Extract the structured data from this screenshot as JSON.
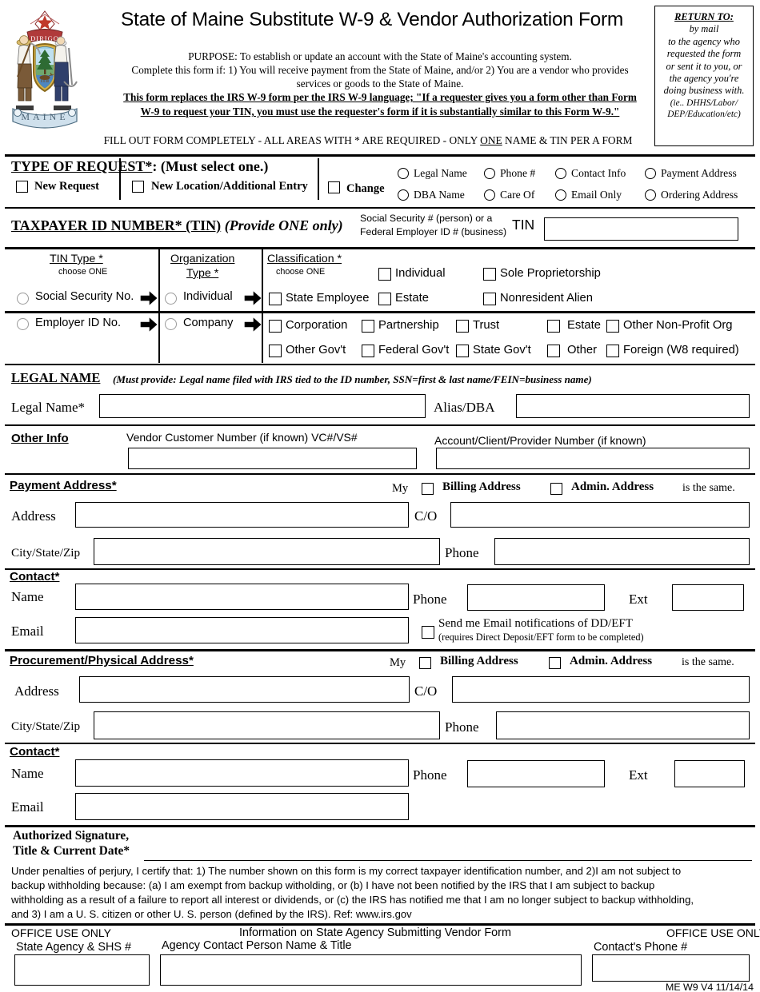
{
  "header": {
    "title": "State of Maine Substitute W-9 & Vendor Authorization Form",
    "seal_alt": "maine-state-seal",
    "purpose_line1": "PURPOSE: To establish or update an account with the State of Maine's accounting system.",
    "purpose_line2": "Complete this form if: 1) You will receive payment from the State of Maine, and/or 2) You are a vendor who provides",
    "purpose_line3": "services or goods to the State of Maine.",
    "replaces_line1": "This form replaces the IRS W-9 form per the IRS W-9 language; \"If a requester gives you a form other than Form",
    "replaces_line2": "W-9 to request your TIN, you must use the requester's form if it is substantially similar to this Form W-9.\"",
    "fillout_pre": "FILL OUT FORM COMPLETELY - ALL AREAS WITH * ARE REQUIRED - ONLY ",
    "fillout_underline": "ONE",
    "fillout_post": " NAME & TIN PER A FORM"
  },
  "return_box": {
    "title": "RETURN TO",
    "title_colon": ":",
    "lines": [
      "by mail",
      "to the agency who",
      "requested the form",
      "or sent it to you, or",
      "the agency you're",
      "doing business with."
    ],
    "small_line1": "(ie.. DHHS/Labor/",
    "small_line2": "DEP/Education/etc)"
  },
  "type_of_request": {
    "heading": "TYPE OF REQUEST*",
    "heading_suffix": ": (Must select one.)",
    "new_request": "New Request",
    "new_location": "New Location/Additional Entry",
    "change": "Change",
    "change_options_row1": [
      "Legal Name",
      "Phone #",
      "Contact Info",
      "Payment Address"
    ],
    "change_options_row2": [
      "DBA Name",
      "Care Of",
      "Email Only",
      "Ordering Address"
    ]
  },
  "tin_section": {
    "heading": "TAXPAYER ID NUMBER* (TIN)",
    "heading_italic": " (Provide ONE only)",
    "hint_line1": "Social Security #  (person) or a",
    "hint_line2": "Federal Employer ID # (business)",
    "tin_label": "TIN",
    "tin_value": ""
  },
  "tin_type": {
    "heading": "TIN Type *",
    "subheading": "choose ONE",
    "options": [
      "Social Security No.",
      "Employer ID No."
    ]
  },
  "org_type": {
    "heading_line1": "Organization",
    "heading_line2": "Type *",
    "options": [
      "Individual",
      "Company"
    ]
  },
  "classification": {
    "heading": "Classification *",
    "subheading": "choose ONE",
    "individual_row1": [
      "Individual",
      "Sole Proprietorship"
    ],
    "individual_row2": [
      "State Employee",
      "Estate",
      "Nonresident Alien"
    ],
    "company_row1": [
      "Corporation",
      "Partnership",
      "Trust",
      "Estate",
      "Other Non-Profit Org"
    ],
    "company_row2": [
      "Other Gov't",
      "Federal Gov't",
      "State Gov't",
      "Other",
      "Foreign (W8 required)"
    ]
  },
  "legal_name": {
    "heading": "LEGAL NAME",
    "heading_note": "(Must provide: Legal name filed with IRS tied to the ID number, SSN=first & last name/FEIN=business name)",
    "legal_name_label": "Legal Name*",
    "legal_name_value": "",
    "alias_label": "Alias/DBA",
    "alias_value": ""
  },
  "other_info": {
    "heading": "Other Info",
    "vendor_number_label": "Vendor Customer Number (if known) VC#/VS#",
    "vendor_number_value": "",
    "account_number_label": "Account/Client/Provider Number (if known)",
    "account_number_value": ""
  },
  "payment_address": {
    "heading": "Payment Address*",
    "same_pre": "My",
    "same_billing": "Billing Address",
    "same_admin": "Admin. Address",
    "same_post": "is the same.",
    "address_label": "Address",
    "address_value": "",
    "co_label": "C/O",
    "co_value": "",
    "citystatezip_label": "City/State/Zip",
    "citystatezip_value": "",
    "phone_label": "Phone",
    "phone_value": "",
    "contact_heading": "Contact*",
    "name_label": "Name",
    "name_value": "",
    "contact_phone_label": "Phone",
    "contact_phone_value": "",
    "ext_label": "Ext",
    "ext_value": "",
    "email_label": "Email",
    "email_value": "",
    "dd_eft_line1": "Send me Email notifications of DD/EFT",
    "dd_eft_line2": "(requires Direct Deposit/EFT form to be completed)"
  },
  "procurement_address": {
    "heading": "Procurement/Physical Address*",
    "same_pre": "My",
    "same_billing": "Billing Address",
    "same_admin": "Admin. Address",
    "same_post": "is the same.",
    "address_label": "Address",
    "address_value": "",
    "co_label": "C/O",
    "co_value": "",
    "citystatezip_label": "City/State/Zip",
    "citystatezip_value": "",
    "phone_label": "Phone",
    "phone_value": "",
    "contact_heading": "Contact*",
    "name_label": "Name",
    "name_value": "",
    "contact_phone_label": "Phone",
    "contact_phone_value": "",
    "ext_label": "Ext",
    "ext_value": "",
    "email_label": "Email",
    "email_value": ""
  },
  "signature": {
    "heading_line1": "Authorized Signature,",
    "heading_line2": "Title &  Current Date*",
    "signature_value": "",
    "perjury_line1": "Under penalties of perjury, I certify that:  1) The number shown on this form is my correct taxpayer identification number, and 2)I am not subject to",
    "perjury_line2": "backup withholding because: (a) I am exempt from backup witholding, or (b) I have not been notified by the IRS that I am subject to backup",
    "perjury_line3": "withholding as a result of a failure to report all interest or dividends, or (c) the IRS has notified me that I am no longer subject to backup withholding,",
    "perjury_line4": "and 3) I am a U. S. citizen or other U. S. person (defined by the IRS). Ref: www.irs.gov"
  },
  "office_use": {
    "left_label": "OFFICE USE ONLY",
    "center_label": "Information on State Agency Submitting Vendor Form",
    "right_label": "OFFICE USE ONLY",
    "state_agency_label": "State Agency & SHS #",
    "state_agency_value": "",
    "agency_contact_label": "Agency Contact Person Name & Title",
    "agency_contact_value": "",
    "contact_phone_label": "Contact's Phone #",
    "contact_phone_value": "",
    "form_version": "ME W9 V4   11/14/14"
  }
}
